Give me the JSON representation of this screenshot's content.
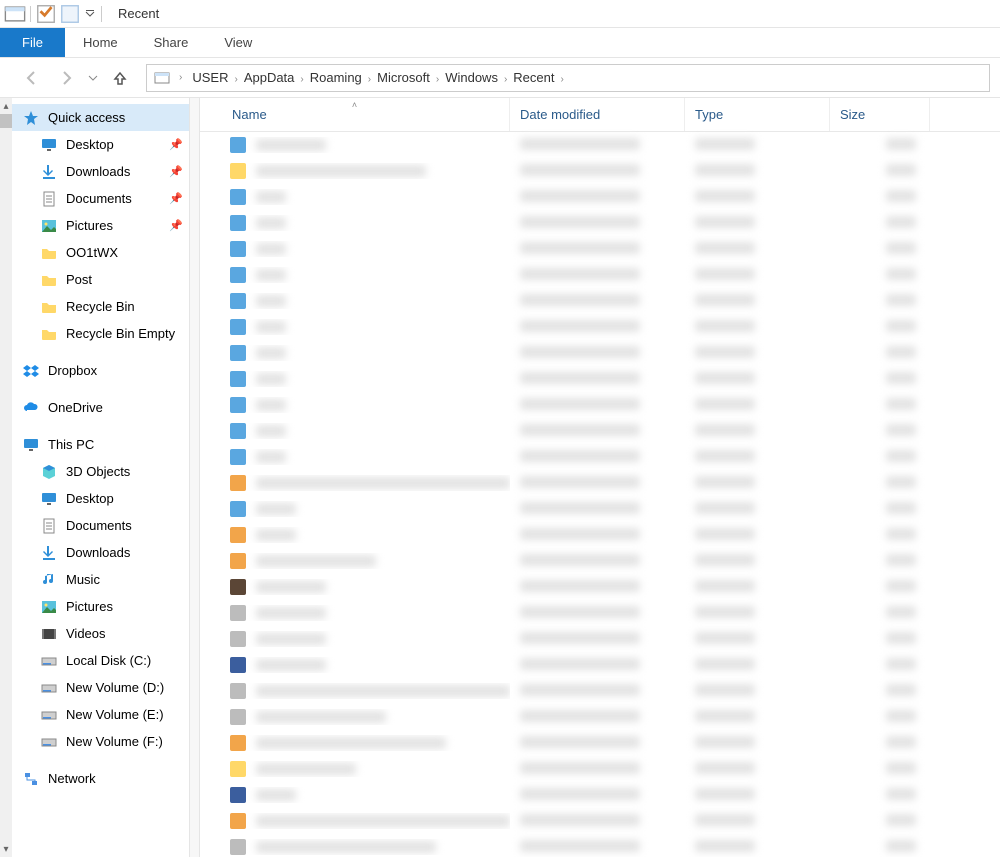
{
  "window": {
    "title": "Recent"
  },
  "ribbon": {
    "file": "File",
    "tabs": [
      "Home",
      "Share",
      "View"
    ]
  },
  "breadcrumbs": [
    "USER",
    "AppData",
    "Roaming",
    "Microsoft",
    "Windows",
    "Recent"
  ],
  "columns": {
    "name": "Name",
    "date": "Date modified",
    "type": "Type",
    "size": "Size"
  },
  "sidebar": {
    "quick_access": {
      "label": "Quick access",
      "items": [
        {
          "label": "Desktop",
          "icon": "monitor",
          "pinned": true
        },
        {
          "label": "Downloads",
          "icon": "download",
          "pinned": true
        },
        {
          "label": "Documents",
          "icon": "doc",
          "pinned": true
        },
        {
          "label": "Pictures",
          "icon": "picture",
          "pinned": true
        },
        {
          "label": "OO1tWX",
          "icon": "folder",
          "pinned": false
        },
        {
          "label": "Post",
          "icon": "folder",
          "pinned": false
        },
        {
          "label": "Recycle Bin",
          "icon": "folder",
          "pinned": false
        },
        {
          "label": "Recycle Bin Empty",
          "icon": "folder",
          "pinned": false
        }
      ]
    },
    "dropbox": {
      "label": "Dropbox"
    },
    "onedrive": {
      "label": "OneDrive"
    },
    "this_pc": {
      "label": "This PC",
      "items": [
        {
          "label": "3D Objects",
          "icon": "cube"
        },
        {
          "label": "Desktop",
          "icon": "monitor"
        },
        {
          "label": "Documents",
          "icon": "doc"
        },
        {
          "label": "Downloads",
          "icon": "download"
        },
        {
          "label": "Music",
          "icon": "music"
        },
        {
          "label": "Pictures",
          "icon": "picture"
        },
        {
          "label": "Videos",
          "icon": "video"
        },
        {
          "label": "Local Disk (C:)",
          "icon": "disk"
        },
        {
          "label": "New Volume (D:)",
          "icon": "disk"
        },
        {
          "label": "New Volume (E:)",
          "icon": "disk"
        },
        {
          "label": "New Volume (F:)",
          "icon": "disk"
        }
      ]
    },
    "network": {
      "label": "Network"
    }
  },
  "files": [
    {
      "icon": "blue",
      "nameW": 70
    },
    {
      "icon": "fold",
      "nameW": 170
    },
    {
      "icon": "blue",
      "nameW": 30
    },
    {
      "icon": "blue",
      "nameW": 30
    },
    {
      "icon": "blue",
      "nameW": 30
    },
    {
      "icon": "blue",
      "nameW": 30
    },
    {
      "icon": "blue",
      "nameW": 30
    },
    {
      "icon": "blue",
      "nameW": 30
    },
    {
      "icon": "blue",
      "nameW": 30
    },
    {
      "icon": "blue",
      "nameW": 30
    },
    {
      "icon": "blue",
      "nameW": 30
    },
    {
      "icon": "blue",
      "nameW": 30
    },
    {
      "icon": "blue",
      "nameW": 30
    },
    {
      "icon": "orange",
      "nameW": 260
    },
    {
      "icon": "blue",
      "nameW": 40
    },
    {
      "icon": "orange",
      "nameW": 40
    },
    {
      "icon": "orange",
      "nameW": 120
    },
    {
      "icon": "dark",
      "nameW": 70
    },
    {
      "icon": "gray",
      "nameW": 70
    },
    {
      "icon": "gray",
      "nameW": 70
    },
    {
      "icon": "navy",
      "nameW": 70
    },
    {
      "icon": "gray",
      "nameW": 260
    },
    {
      "icon": "gray",
      "nameW": 130
    },
    {
      "icon": "orange",
      "nameW": 190
    },
    {
      "icon": "fold",
      "nameW": 100
    },
    {
      "icon": "navy",
      "nameW": 40
    },
    {
      "icon": "orange",
      "nameW": 260
    },
    {
      "icon": "gray",
      "nameW": 180
    }
  ],
  "file_row_defaults": {
    "dateW": 120,
    "typeW": 60,
    "sizeW": 30
  }
}
